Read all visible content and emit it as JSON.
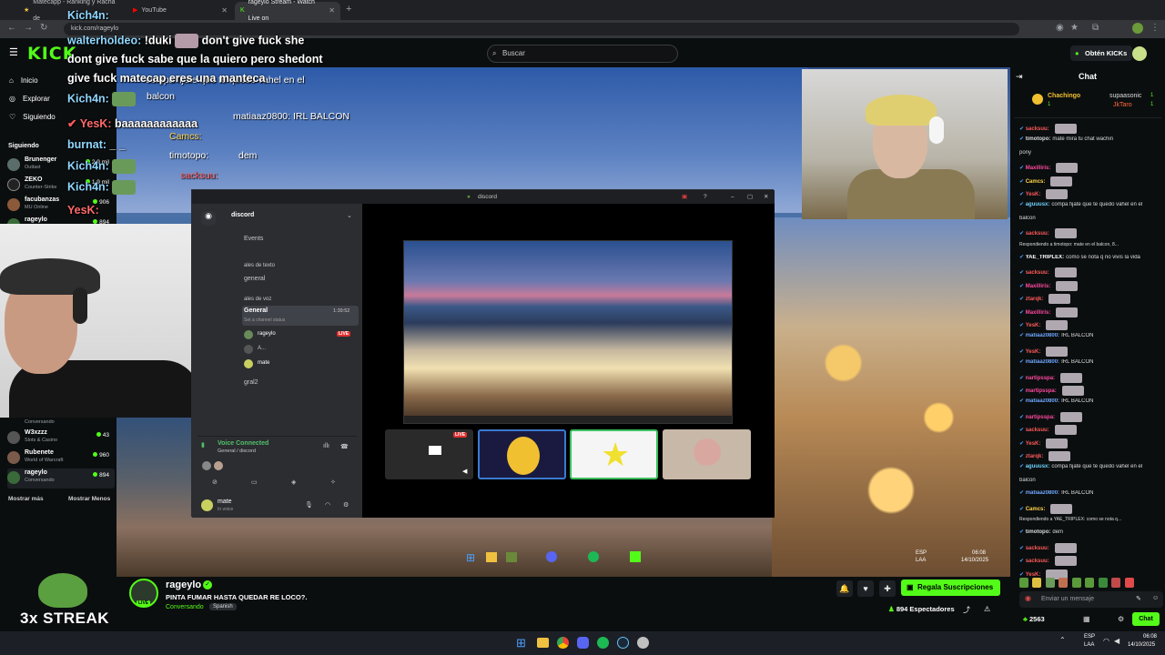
{
  "browser": {
    "tabs": [
      {
        "title": "Matecapp - Ranking y Racha de"
      },
      {
        "title": "YouTube"
      },
      {
        "title": "rageylo Stream - Watch Live on"
      }
    ],
    "url": "kick.com/rageylo"
  },
  "header": {
    "logo": "KICK",
    "search_placeholder": "Buscar",
    "get_kicks": "Obtén KICKs"
  },
  "leftnav": {
    "items": [
      "Inicio",
      "Explorar",
      "Siguiendo"
    ],
    "section": "Siguiendo",
    "following": [
      {
        "name": "Brunenger",
        "game": "Outlast",
        "viewers": "2.9 mil"
      },
      {
        "name": "ZEKO",
        "game": "Counter-Strike",
        "viewers": "1.9 mil"
      },
      {
        "name": "facubanzas",
        "game": "MU Online",
        "viewers": "906"
      },
      {
        "name": "rageylo",
        "game": "",
        "viewers": "894"
      }
    ],
    "following_lower": [
      {
        "name": "",
        "game": "Conversando",
        "viewers": ""
      },
      {
        "name": "W3xzzz",
        "game": "Slots & Casino",
        "viewers": "43"
      },
      {
        "name": "Rubenete",
        "game": "World of Warcraft",
        "viewers": "960"
      },
      {
        "name": "rageylo",
        "game": "Conversando",
        "viewers": "894"
      }
    ],
    "show_more": "Mostrar más",
    "show_less": "Mostrar Menos"
  },
  "overlay_chat": [
    {
      "name": "Kich4n:",
      "text": ""
    },
    {
      "name": "walterholdeo:",
      "text": "!duki"
    },
    {
      "name": "",
      "text": "don't give fuck she"
    },
    {
      "name": "",
      "text": "dont give fuck sabe que la quiero pero shedont"
    },
    {
      "name": "",
      "text": "give fuck matecap eres una manteca"
    },
    {
      "name": "Kich4n:",
      "text": ""
    },
    {
      "name": "YesK:",
      "text": "baaaaaaaaaaaa"
    },
    {
      "name": "burnat:",
      "text": "_ _"
    },
    {
      "name": "Kich4n:",
      "text": ""
    },
    {
      "name": "Kich4n:",
      "text": ""
    },
    {
      "name": "YesK:",
      "text": ""
    }
  ],
  "overlay_chat_small": [
    {
      "text": "compa fijate que te quedo vahel en el"
    },
    {
      "text": "balcon"
    },
    {
      "text": "matiaaz0800: IRL BALCON"
    },
    {
      "text": "Camcs:"
    },
    {
      "text": "timotopo:"
    },
    {
      "text": "dem"
    },
    {
      "text": "sacksuu:"
    }
  ],
  "discord": {
    "window_title": "discord",
    "server": "discord",
    "events": "Events",
    "text_category": "ales de texto",
    "text_channel": "general",
    "voice_category": "ales de voz",
    "voice_channel": "General",
    "voice_time": "1:39:52",
    "voice_status": "Set a channel status",
    "members": [
      {
        "name": "rageylo",
        "live": "LIVE"
      },
      {
        "name": "A...",
        "live": ""
      },
      {
        "name": "mate",
        "live": ""
      }
    ],
    "voice2": "gral2",
    "voice_connected": "Voice Connected",
    "voice_connected_sub": "General / discord",
    "user_name": "mate",
    "user_status": "In voice",
    "tile_live": "LIVE"
  },
  "stream_taskbar": {
    "lang": "ESP",
    "lang2": "LAA",
    "time": "06:08",
    "date": "14/10/2025"
  },
  "info": {
    "streak": "3x STREAK",
    "streamer": "rageylo",
    "title": "PINTA FUMAR HASTA QUEDAR RE LOCO?.",
    "category": "Conversando",
    "language": "Spanish",
    "sub_button": "Regala Suscripciones",
    "viewers": "894 Espectadores",
    "live_badge": "LIVE"
  },
  "chat": {
    "title": "Chat",
    "leaderboard": [
      {
        "name": "Chachingo",
        "rank": "1"
      },
      {
        "name": "supaasonic",
        "rank": "1"
      },
      {
        "name": "JkTaro",
        "rank": "1"
      }
    ],
    "messages": [
      {
        "name": "sacksuu:",
        "text": "",
        "color": "#ff5a5a"
      },
      {
        "name": "timotopo:",
        "text": "mate mira tu chat wachin",
        "color": "#dcdcdc"
      },
      {
        "name": "",
        "text": "pony",
        "color": "#dcdcdc"
      },
      {
        "name": "Maxilliris:",
        "text": "",
        "color": "#ff4aa0"
      },
      {
        "name": "Camcs:",
        "text": "",
        "color": "#ffd34a"
      },
      {
        "name": "YesK:",
        "text": "",
        "color": "#ff5a5a"
      },
      {
        "name": "aguuusx:",
        "text": "compa fijate que te quedo vahel en el",
        "color": "#6fd3ff"
      },
      {
        "name": "",
        "text": "balcon",
        "color": "#dcdcdc"
      },
      {
        "name": "sacksuu:",
        "text": "",
        "color": "#ff5a5a"
      },
      {
        "name": "",
        "text": "Respondiendo a timotopo: mate en el balcon, 8...",
        "color": "#888888"
      },
      {
        "name": "YAE_TRIPLEX:",
        "text": "como se nota q no vivis la vida",
        "color": "#ffffff"
      },
      {
        "name": "sacksuu:",
        "text": "",
        "color": "#ff5a5a"
      },
      {
        "name": "Maxilliris:",
        "text": "",
        "color": "#ff4aa0"
      },
      {
        "name": "ztarqk:",
        "text": "",
        "color": "#ff5a5a"
      },
      {
        "name": "Maxilliris:",
        "text": "",
        "color": "#ff4aa0"
      },
      {
        "name": "YesK:",
        "text": "",
        "color": "#ff5a5a"
      },
      {
        "name": "matiaaz0800:",
        "text": "IRL BALCON",
        "color": "#6fa8ff"
      },
      {
        "name": "YesK:",
        "text": "",
        "color": "#ff5a5a"
      },
      {
        "name": "matiaaz0800:",
        "text": "IRL BALCON",
        "color": "#6fa8ff"
      },
      {
        "name": "nartipsspa:",
        "text": "",
        "color": "#ff4aa0"
      },
      {
        "name": "martipsspa:",
        "text": "",
        "color": "#ff4aa0"
      },
      {
        "name": "matiaaz0800:",
        "text": "IRL BALCON",
        "color": "#6fa8ff"
      },
      {
        "name": "nartipsspa:",
        "text": "",
        "color": "#ff4aa0"
      },
      {
        "name": "sacksuu:",
        "text": "",
        "color": "#ff5a5a"
      },
      {
        "name": "YesK:",
        "text": "",
        "color": "#ff5a5a"
      },
      {
        "name": "ztarqk:",
        "text": "",
        "color": "#ff5a5a"
      },
      {
        "name": "aguuusx:",
        "text": "compa fijate que te quedo vahel en el",
        "color": "#6fd3ff"
      },
      {
        "name": "",
        "text": "balcon",
        "color": "#dcdcdc"
      },
      {
        "name": "matiaaz0800:",
        "text": "IRL BALCON",
        "color": "#6fa8ff"
      },
      {
        "name": "Camcs:",
        "text": "",
        "color": "#ffd34a"
      },
      {
        "name": "",
        "text": "Respondiendo a YAE_TRIPLEX: como se nota q...",
        "color": "#888888"
      },
      {
        "name": "timotopo:",
        "text": "dem",
        "color": "#dcdcdc"
      },
      {
        "name": "sacksuu:",
        "text": "",
        "color": "#ff5a5a"
      },
      {
        "name": "sacksuu:",
        "text": "",
        "color": "#ff5a5a"
      },
      {
        "name": "YesK:",
        "text": "",
        "color": "#ff5a5a"
      }
    ],
    "input_placeholder": "Enviar un mensaje",
    "points": "2563",
    "send": "Chat"
  },
  "os_taskbar": {
    "lang": "ESP",
    "lang2": "LAA",
    "time": "06:08",
    "date": "14/10/2025"
  },
  "colors": {
    "kick_green": "#53fc18",
    "bg": "#0b0e0f",
    "discord_bg": "#2b2d31"
  }
}
